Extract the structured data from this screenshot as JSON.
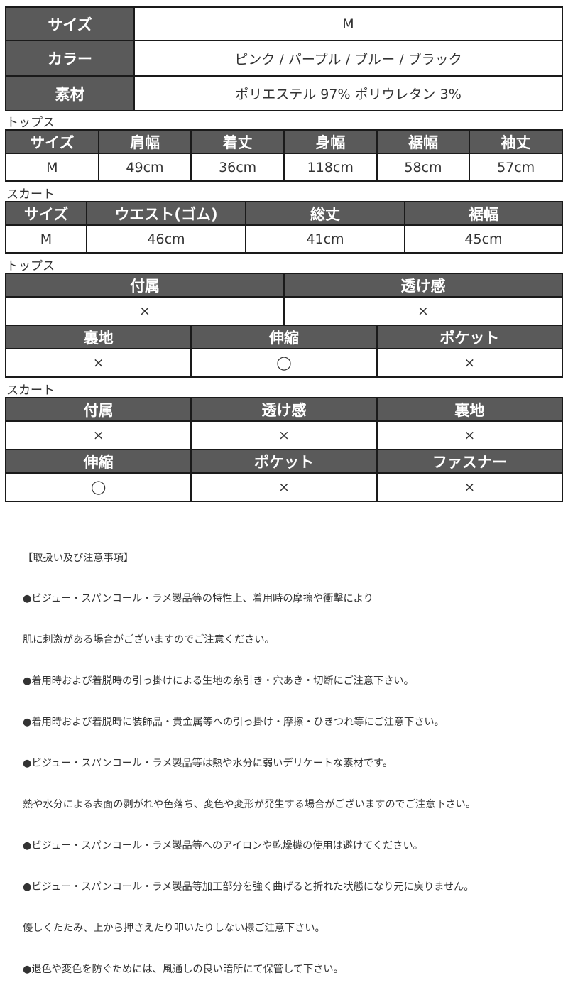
{
  "spec_table": {
    "rows": [
      {
        "label": "サイズ",
        "value": "M"
      },
      {
        "label": "カラー",
        "value": "ピンク / パープル / ブルー / ブラック"
      },
      {
        "label": "素材",
        "value": "ポリエステル 97%  ポリウレタン 3%"
      }
    ]
  },
  "tops_size": {
    "section_label": "トップス",
    "headers": [
      "サイズ",
      "肩幅",
      "着丈",
      "身幅",
      "裾幅",
      "袖丈"
    ],
    "values": [
      "M",
      "49cm",
      "36cm",
      "118cm",
      "58cm",
      "57cm"
    ]
  },
  "skirt_size": {
    "section_label": "スカート",
    "headers": [
      "サイズ",
      "ウエスト(ゴム)",
      "総丈",
      "裾幅"
    ],
    "values": [
      "M",
      "46cm",
      "41cm",
      "45cm"
    ]
  },
  "tops_features": {
    "section_label": "トップス",
    "row1_headers": [
      "付属",
      "透け感"
    ],
    "row1_values": [
      "×",
      "×"
    ],
    "row2_headers": [
      "裏地",
      "伸縮",
      "ポケット"
    ],
    "row2_values": [
      "×",
      "◯",
      "×"
    ]
  },
  "skirt_features": {
    "section_label": "スカート",
    "row1_headers": [
      "付属",
      "透け感",
      "裏地"
    ],
    "row1_values": [
      "×",
      "×",
      "×"
    ],
    "row2_headers": [
      "伸縮",
      "ポケット",
      "ファスナー"
    ],
    "row2_values": [
      "◯",
      "×",
      "×"
    ]
  },
  "care_notes": {
    "title": "【取扱い及び注意事項】",
    "lines": [
      "●ビジュー・スパンコール・ラメ製品等の特性上、着用時の摩擦や衝撃により",
      "肌に刺激がある場合がございますのでご注意ください。",
      "●着用時および着脱時の引っ掛けによる生地の糸引き・穴あき・切断にご注意下さい。",
      "●着用時および着脱時に装飾品・貴金属等への引っ掛け・摩擦・ひきつれ等にご注意下さい。",
      "●ビジュー・スパンコール・ラメ製品等は熱や水分に弱いデリケートな素材です。",
      "熱や水分による表面の剥がれや色落ち、変色や変形が発生する場合がございますのでご注意下さい。",
      "●ビジュー・スパンコール・ラメ製品等へのアイロンや乾燥機の使用は避けてください。",
      "●ビジュー・スパンコール・ラメ製品等加工部分を強く曲げると折れた状態になり元に戻りません。",
      "優しくたたみ、上から押さえたり叩いたりしない様ご注意下さい。",
      "●退色や変色を防ぐためには、風通しの良い暗所にて保管して下さい。"
    ]
  },
  "colors": {
    "header_bg": "#5a5a5a",
    "border": "#1a1a1a",
    "text": "#333333"
  }
}
